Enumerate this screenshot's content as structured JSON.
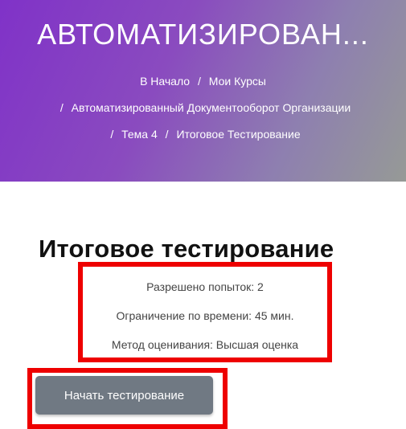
{
  "header": {
    "title": "АВТОМАТИЗИРОВАН...",
    "breadcrumb": {
      "home": "В Начало",
      "my_courses": "Мои Курсы",
      "course": "Автоматизированный Документооборот Организации",
      "topic": "Тема 4",
      "current": "Итоговое Тестирование",
      "separator": "/"
    }
  },
  "quiz": {
    "title": "Итоговое тестирование",
    "attempts": "Разрешено попыток: 2",
    "time_limit": "Ограничение по времени: 45 мин.",
    "grading": "Метод оценивания: Высшая оценка",
    "start_button": "Начать тестирование"
  },
  "colors": {
    "hero_gradient_start": "#8032c8",
    "hero_gradient_end": "#969a96",
    "highlight_border": "#ee0000",
    "button_bg": "#707983"
  }
}
